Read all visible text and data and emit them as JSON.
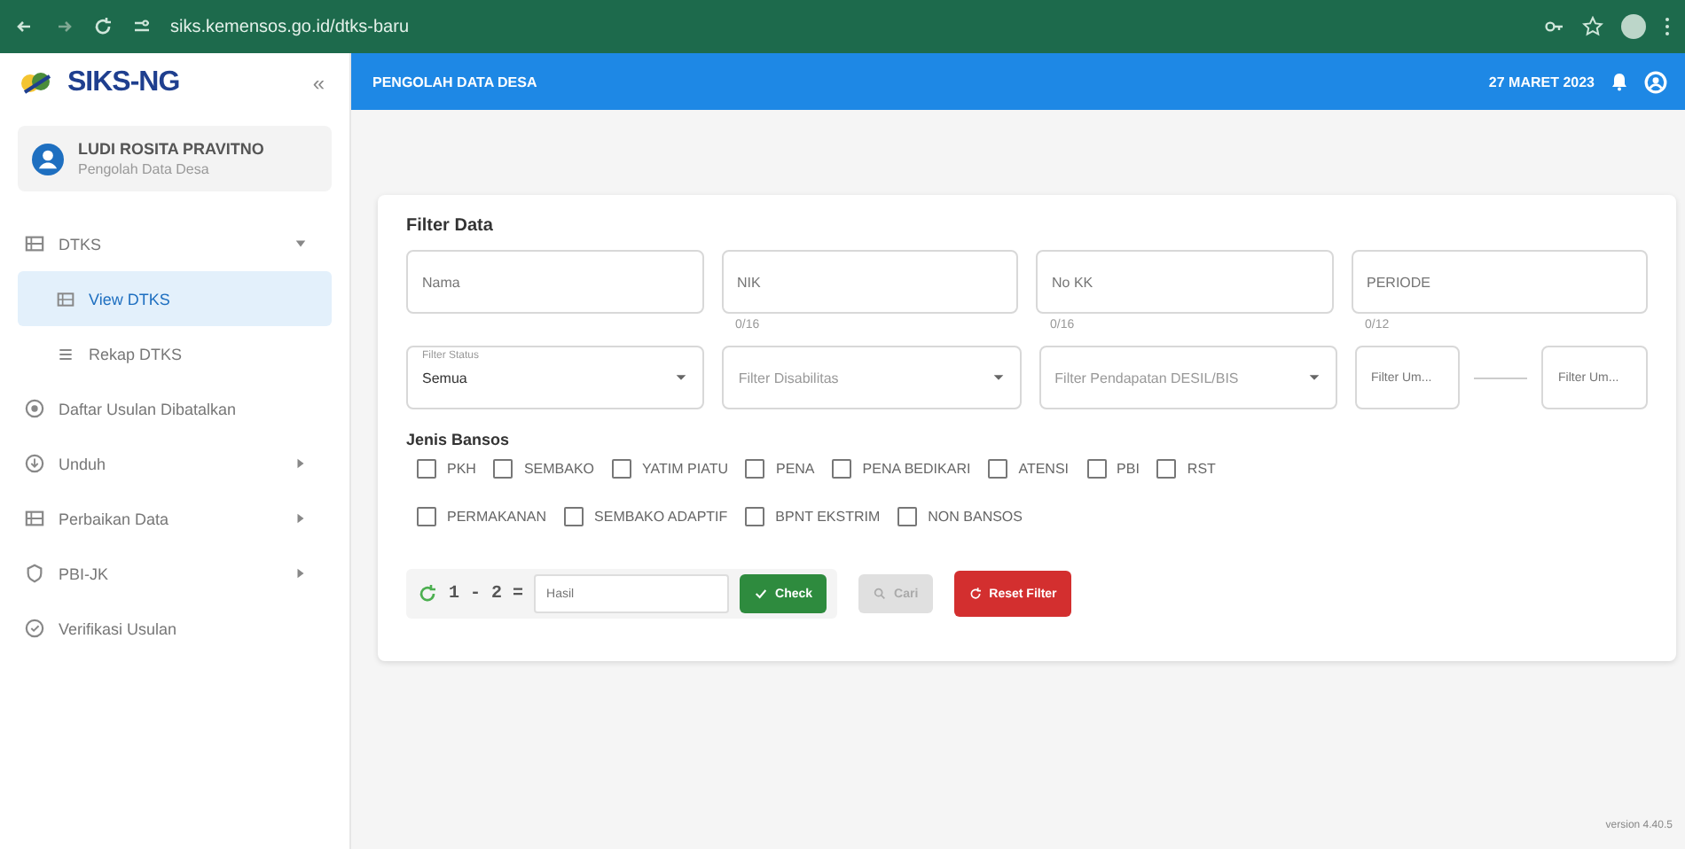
{
  "browser": {
    "url": "siks.kemensos.go.id/dtks-baru"
  },
  "sidebar": {
    "logo": "SIKS-NG",
    "collapse": "«",
    "user": {
      "name": "LUDI ROSITA PRAVITNO",
      "role": "Pengolah Data Desa"
    },
    "items": [
      {
        "label": "DTKS",
        "expanded": true,
        "children": [
          {
            "label": "View DTKS",
            "selected": true
          },
          {
            "label": "Rekap DTKS",
            "selected": false
          }
        ],
        "selected": false
      },
      {
        "label": "Daftar Usulan Dibatalkan",
        "selected": false
      },
      {
        "label": "Unduh",
        "expanded": false,
        "selected": false
      },
      {
        "label": "Perbaikan Data",
        "expanded": false,
        "selected": false
      },
      {
        "label": "PBI-JK",
        "expanded": false,
        "selected": false
      },
      {
        "label": "Verifikasi Usulan",
        "selected": false
      }
    ]
  },
  "header": {
    "title": "PENGOLAH DATA DESA",
    "date": "27 MARET 2023"
  },
  "filter": {
    "title": "Filter Data",
    "text_fields": [
      {
        "placeholder": "Nama"
      },
      {
        "placeholder": "NIK",
        "counter": "0/16"
      },
      {
        "placeholder": "No KK",
        "counter": "0/16"
      },
      {
        "placeholder": "PERIODE",
        "counter": "0/12"
      }
    ],
    "selects": [
      {
        "label": "Filter Status",
        "value": "Semua"
      },
      {
        "placeholder": "Filter Disabilitas"
      },
      {
        "placeholder": "Filter Pendapatan DESIL/BIS"
      }
    ],
    "range": [
      {
        "placeholder": "Filter Um..."
      },
      {
        "placeholder": "Filter Um..."
      }
    ],
    "bansos_title": "Jenis Bansos",
    "bansos": [
      {
        "label": "PKH",
        "checked": false
      },
      {
        "label": "SEMBAKO",
        "checked": false
      },
      {
        "label": "YATIM PIATU",
        "checked": false
      },
      {
        "label": "PENA",
        "checked": false
      },
      {
        "label": "PENA BEDIKARI",
        "checked": false
      },
      {
        "label": "ATENSI",
        "checked": false
      },
      {
        "label": "PBI",
        "checked": false
      },
      {
        "label": "RST",
        "checked": false
      },
      {
        "label": "PERMAKANAN",
        "checked": false
      },
      {
        "label": "SEMBAKO ADAPTIF",
        "checked": false
      },
      {
        "label": "BPNT EKSTRIM",
        "checked": false
      },
      {
        "label": "NON BANSOS",
        "checked": false
      }
    ],
    "captcha": {
      "question": "1 - 2 =",
      "placeholder": "Hasil",
      "check": "Check"
    },
    "search_button": {
      "label": "Cari",
      "disabled": true
    },
    "reset_button": "Reset Filter"
  },
  "version": "version 4.40.5"
}
